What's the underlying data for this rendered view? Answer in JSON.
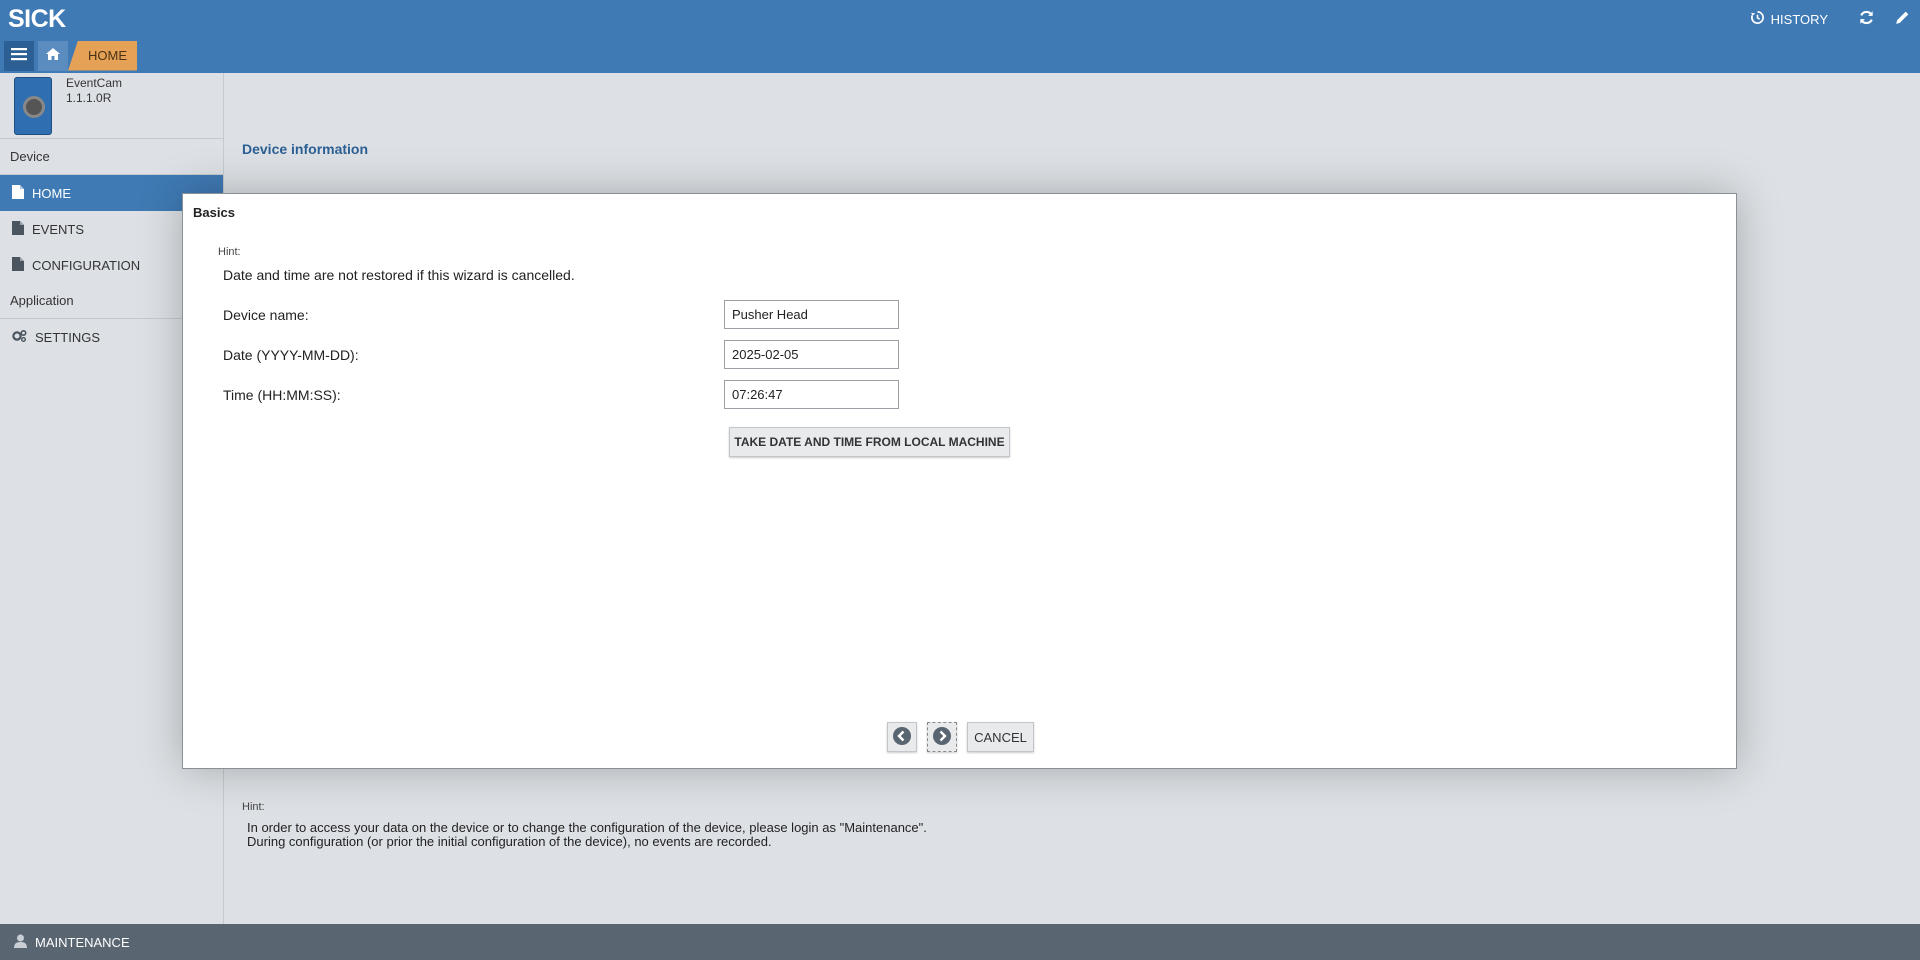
{
  "app": {
    "logo": "SICK"
  },
  "header": {
    "history_label": "HISTORY",
    "breadcrumb_current": "HOME"
  },
  "sidebar": {
    "device_name": "EventCam",
    "device_version": "1.1.1.0R",
    "section_device": "Device",
    "items": [
      {
        "label": "HOME",
        "icon": "document-icon",
        "active": true
      },
      {
        "label": "EVENTS",
        "icon": "document-icon",
        "active": false
      },
      {
        "label": "CONFIGURATION",
        "icon": "document-icon",
        "active": false
      }
    ],
    "section_application": "Application",
    "settings_label": "SETTINGS"
  },
  "main": {
    "title": "Device information",
    "hint_label": "Hint:",
    "hint_text": "In order to access your data on the device or to change the configuration of the device, please login as \"Maintenance\". During configuration (or prior the initial configuration of the device), no events are recorded."
  },
  "dialog": {
    "title": "Basics",
    "hint_label": "Hint:",
    "hint_text": "Date and time are not restored if this wizard is cancelled.",
    "device_name_label": "Device name:",
    "device_name_value": "Pusher Head",
    "date_label": "Date (YYYY-MM-DD):",
    "date_value": "2025-02-05",
    "time_label": "Time (HH:MM:SS):",
    "time_value": "07:26:47",
    "take_button_label": "TAKE DATE AND TIME FROM LOCAL MACHINE",
    "cancel_label": "CANCEL"
  },
  "footer": {
    "user_label": "MAINTENANCE"
  },
  "colors": {
    "primary": "#3f7ab4",
    "accent": "#e5a257",
    "footer": "#5a6572"
  }
}
